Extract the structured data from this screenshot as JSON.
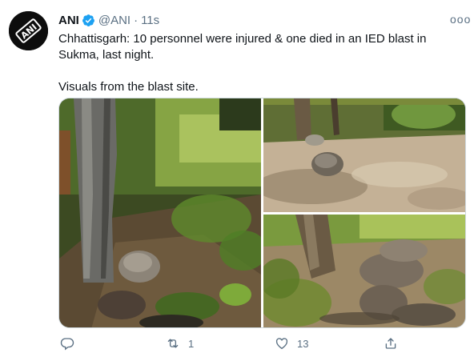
{
  "tweet": {
    "author_name": "ANI",
    "author_handle": "@ANI",
    "separator": "·",
    "timestamp": "11s",
    "more_label": "ooo",
    "avatar_logo_text": "ANI",
    "text_line1": "Chhattisgarh: 10 personnel were injured & one died in an IED blast in Sukma, last night.",
    "text_line2": "Visuals from the blast site.",
    "media_count": 3,
    "actions": {
      "reply_count": "",
      "retweet_count": "1",
      "like_count": "13",
      "share_count": ""
    },
    "colors": {
      "text": "#0f1419",
      "muted": "#5b7083",
      "verified": "#1da1f2",
      "border": "#cfd9de"
    },
    "icons": [
      "verified-badge-icon",
      "more-icon",
      "reply-icon",
      "retweet-icon",
      "like-icon",
      "share-icon"
    ]
  }
}
